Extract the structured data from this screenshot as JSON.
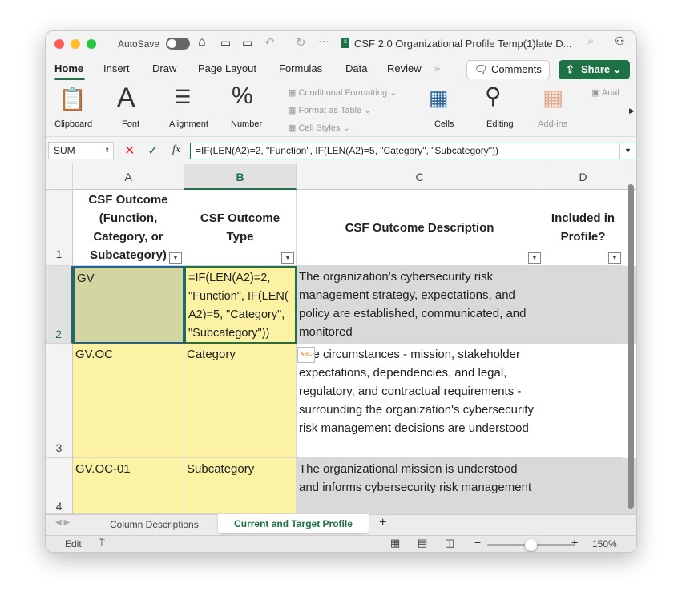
{
  "titlebar": {
    "autosave": "AutoSave",
    "title": "CSF 2.0 Organizational Profile Temp(1)late D..."
  },
  "tabs": [
    "Home",
    "Insert",
    "Draw",
    "Page Layout",
    "Formulas",
    "Data",
    "Review"
  ],
  "more": "»",
  "comments": "Comments",
  "share": "Share",
  "ribbon": {
    "clipboard": "Clipboard",
    "font": "Font",
    "alignment": "Alignment",
    "number": "Number",
    "cond_format": "Conditional Formatting",
    "format_table": "Format as Table",
    "cell_styles": "Cell Styles",
    "cells": "Cells",
    "editing": "Editing",
    "addins": "Add-ins",
    "anal": "Anal"
  },
  "formula_bar": {
    "name_box": "SUM",
    "fx": "fx",
    "formula": "=IF(LEN(A2)=2, \"Function\", IF(LEN(A2)=5, \"Category\", \"Subcategory\"))"
  },
  "columns": [
    "A",
    "B",
    "C",
    "D"
  ],
  "rows": [
    "1",
    "2",
    "3",
    "4"
  ],
  "headers": {
    "a": "CSF Outcome (Function, Category, or Subcategory)",
    "b": "CSF Outcome Type",
    "c": "CSF Outcome Description",
    "d": "Included in Profile?"
  },
  "data": [
    {
      "a": "GV",
      "b": "=IF(LEN(A2)=2, \"Function\", IF(LEN( A2)=5, \"Category\", \"Subcategory\"))",
      "c": "The organization's cybersecurity risk management strategy, expectations, and policy are established, communicated, and monitored"
    },
    {
      "a": "GV.OC",
      "b": "Category",
      "c": "The circumstances - mission, stakeholder expectations, dependencies, and legal, regulatory, and contractual requirements - surrounding the organization's cybersecurity risk management decisions are understood"
    },
    {
      "a": "GV.OC-01",
      "b": "Subcategory",
      "c": "The organizational mission is understood and informs cybersecurity risk management"
    }
  ],
  "sheets": [
    "Column Descriptions",
    "Current and Target Profile"
  ],
  "status": {
    "mode": "Edit",
    "zoom": "150%",
    "zoom_level": 150
  },
  "colors": {
    "green": "#1e7145",
    "yellow": "#fbf3a3",
    "gray": "#d9d9d9"
  }
}
